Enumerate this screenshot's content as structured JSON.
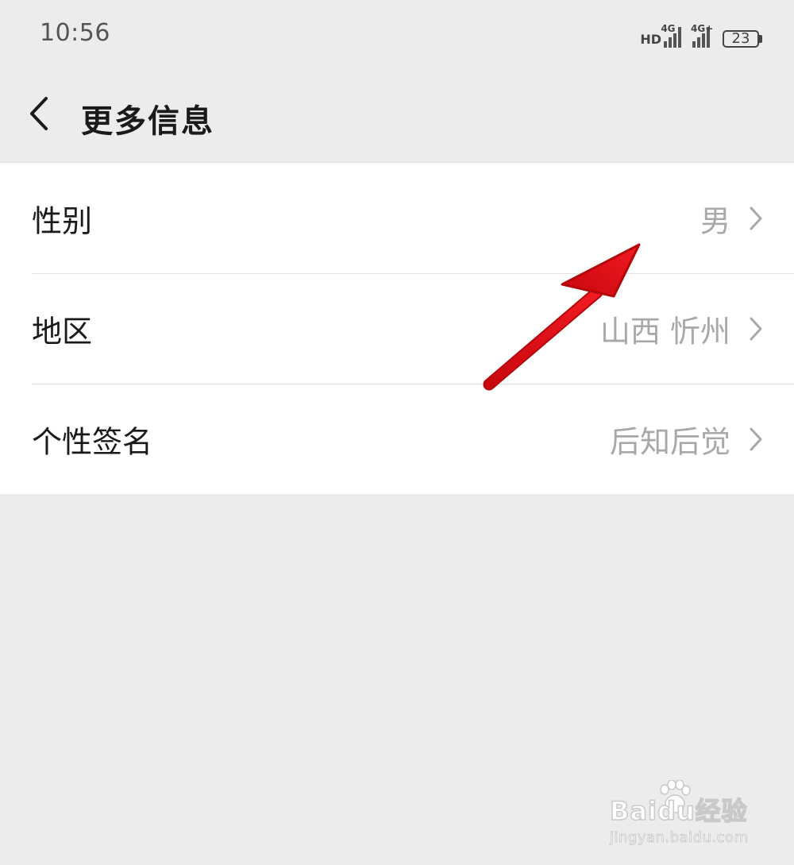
{
  "status_bar": {
    "time": "10:56",
    "signal_1": {
      "hd": "HD",
      "type": "4G"
    },
    "signal_2": {
      "type": "4G+"
    },
    "battery": "23"
  },
  "header": {
    "title": "更多信息"
  },
  "items": [
    {
      "label": "性别",
      "value": "男"
    },
    {
      "label": "地区",
      "value": "山西 忻州"
    },
    {
      "label": "个性签名",
      "value": "后知后觉"
    }
  ],
  "watermark": {
    "logo": "Baidu经验",
    "url": "jingyan.baidu.com"
  },
  "colors": {
    "background": "#ececec",
    "surface": "#ffffff",
    "text_primary": "#1a1a1a",
    "text_secondary": "#a8a8a8",
    "annotation_arrow": "#e8141b"
  },
  "icons": {
    "back": "chevron-left-icon",
    "row_arrow": "chevron-right-icon",
    "annotation": "red-arrow-annotation"
  }
}
